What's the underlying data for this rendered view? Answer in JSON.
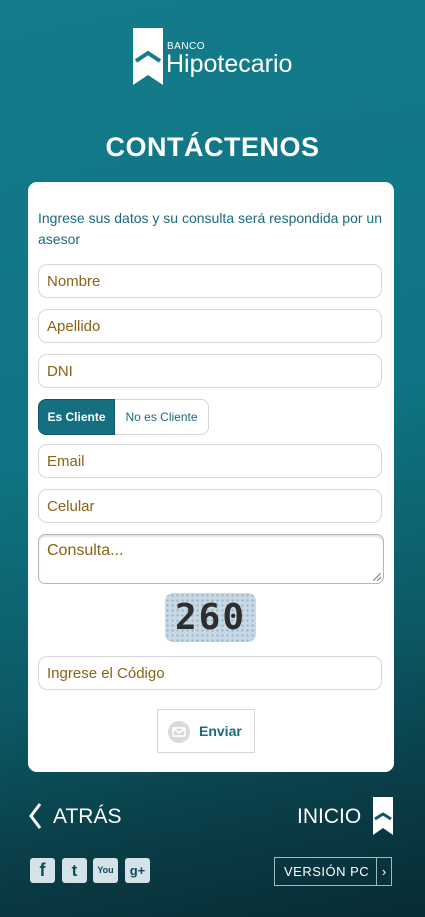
{
  "brand": {
    "small": "BANCO",
    "big": "Hipotecario"
  },
  "page": {
    "title": "CONTÁCTENOS"
  },
  "form": {
    "intro": "Ingrese sus datos y su consulta será respondida por un asesor",
    "nombre_placeholder": "Nombre",
    "apellido_placeholder": "Apellido",
    "dni_placeholder": "DNI",
    "toggle": {
      "active": "Es Cliente",
      "inactive": "No es Cliente"
    },
    "email_placeholder": "Email",
    "celular_placeholder": "Celular",
    "consulta_placeholder": "Consulta...",
    "captcha_text": "260",
    "code_placeholder": "Ingrese el Código",
    "send_label": "Enviar",
    "send_icon": "envelope-icon"
  },
  "nav": {
    "back_label": "ATRÁS",
    "home_label": "INICIO",
    "home_icon": "bank-logo-icon"
  },
  "footer": {
    "social": [
      {
        "name": "facebook",
        "glyph": "f"
      },
      {
        "name": "twitter",
        "glyph": "t"
      },
      {
        "name": "youtube",
        "glyph": "You"
      },
      {
        "name": "googleplus",
        "glyph": "g+"
      }
    ],
    "pc_label": "VERSIÓN PC"
  },
  "colors": {
    "accent": "#156f80",
    "placeholder": "#8a6318",
    "text": "#1a6a7c"
  }
}
